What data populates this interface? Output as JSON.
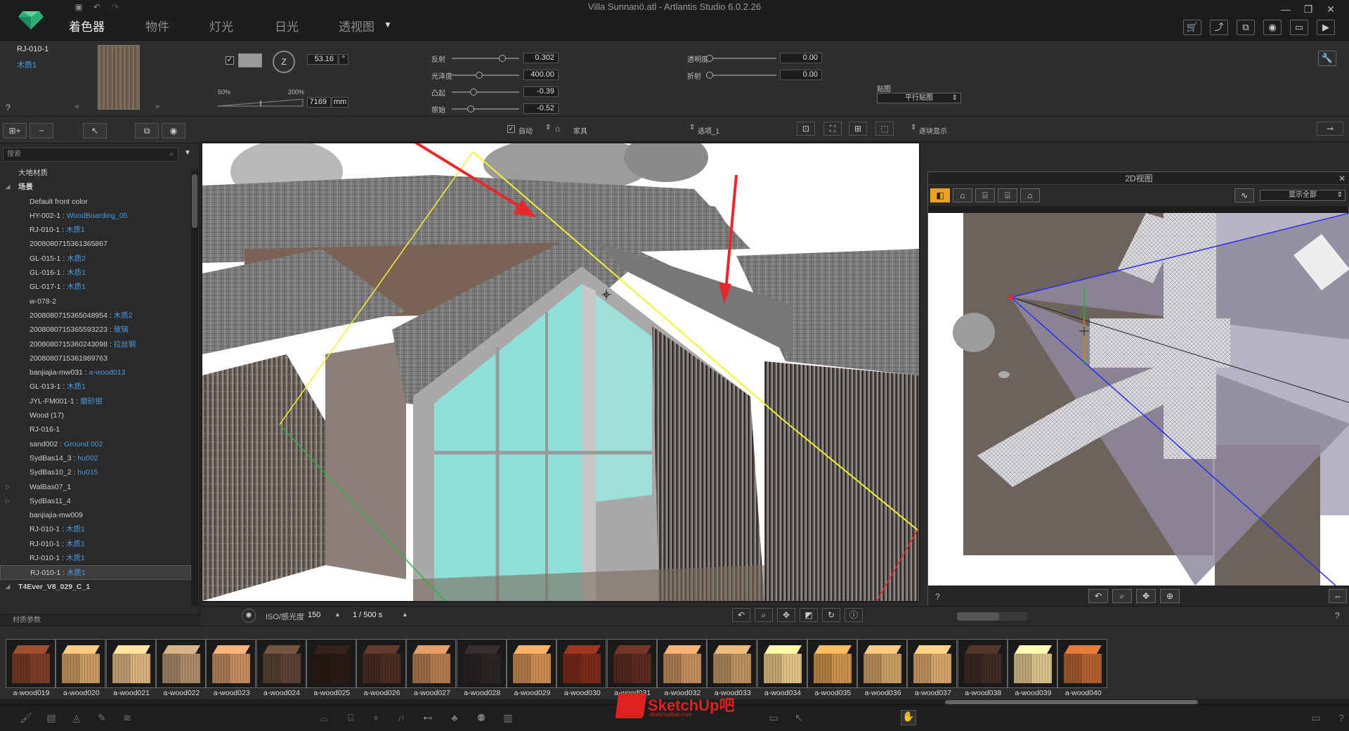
{
  "titlebar": {
    "window_title": "Villa Sunnanö.atl - Artlantis Studio 6.0.2.26",
    "tabs": [
      "着色器",
      "物件",
      "灯光",
      "日光",
      "透视图"
    ],
    "tab_dropdown": "▼",
    "window_controls": [
      "—",
      "❐",
      "✕"
    ],
    "toolbar_icons": [
      "cart-icon",
      "export-icon",
      "windows-icon",
      "camera-icon",
      "crop-icon",
      "render-icon"
    ]
  },
  "props": {
    "material_code": "RJ-010-1",
    "material_name": "木质1",
    "help": "?",
    "rotation_value": "53.16",
    "rotation_unit": "°",
    "rotation_axis": "Z",
    "scale_min": "50%",
    "scale_max": "200%",
    "size_value": "7169",
    "size_unit": "mm",
    "sliders_left": [
      {
        "label": "反射",
        "value": "0.302",
        "pos": 0.78
      },
      {
        "label": "光泽度",
        "value": "400.00",
        "pos": 0.4
      },
      {
        "label": "凸起",
        "value": "-0.39",
        "pos": 0.3
      },
      {
        "label": "原始",
        "value": "-0.52",
        "pos": 0.25
      }
    ],
    "sliders_right": [
      {
        "label": "透明度",
        "value": "0.00",
        "pos": 0.0
      },
      {
        "label": "折射",
        "value": "0.00",
        "pos": 0.0
      }
    ],
    "mapping_label": "贴图",
    "mapping_value": "平行贴图",
    "tool_icon": "wrench-icon"
  },
  "left": {
    "search_placeholder": "搜索",
    "tree": [
      {
        "text": "大地材质",
        "sub": "",
        "indent": 1,
        "bold": false
      },
      {
        "text": "场景",
        "sub": "",
        "indent": 1,
        "bold": true,
        "expand": "◢"
      },
      {
        "text": "Default front color",
        "sub": "",
        "indent": 2
      },
      {
        "text": "HY-002-1 : ",
        "sub": "WoodBoarding_05",
        "indent": 2
      },
      {
        "text": "RJ-010-1 : ",
        "sub": "木质1",
        "indent": 2
      },
      {
        "text": "20080807153613658​67",
        "sub": "",
        "indent": 2
      },
      {
        "text": "GL-015-1 : ",
        "sub": "木质2",
        "indent": 2
      },
      {
        "text": "GL-016-1 : ",
        "sub": "木质1",
        "indent": 2
      },
      {
        "text": "GL-017-1 : ",
        "sub": "木质1",
        "indent": 2
      },
      {
        "text": "w-078-2",
        "sub": "",
        "indent": 2
      },
      {
        "text": "2008080715365048954 : ",
        "sub": "木质2",
        "indent": 2
      },
      {
        "text": "2008080715365593223 : ",
        "sub": "玻璃",
        "indent": 2
      },
      {
        "text": "2008080715360243098 : ",
        "sub": "拉丝钢",
        "indent": 2
      },
      {
        "text": "2008080715361989763",
        "sub": "",
        "indent": 2
      },
      {
        "text": "banjiajia-mw031 : ",
        "sub": "a-wood013",
        "indent": 2
      },
      {
        "text": "GL-013-1 : ",
        "sub": "木质1",
        "indent": 2
      },
      {
        "text": "JYL-FM001-1 : ",
        "sub": "磨砂银",
        "indent": 2
      },
      {
        "text": "Wood (17)",
        "sub": "",
        "indent": 2
      },
      {
        "text": "RJ-016-1",
        "sub": "",
        "indent": 2
      },
      {
        "text": "sand002 : ",
        "sub": "Ground 002",
        "indent": 2
      },
      {
        "text": "SydBas14_3 : ",
        "sub": "hu002",
        "indent": 2
      },
      {
        "text": "SydBas10_2 : ",
        "sub": "hu015",
        "indent": 2
      },
      {
        "text": "WalBas07_1",
        "sub": "",
        "indent": 2,
        "expand": "▷"
      },
      {
        "text": "SydBas11_4",
        "sub": "",
        "indent": 2,
        "expand": "▷"
      },
      {
        "text": "banjiajia-mw009",
        "sub": "",
        "indent": 2
      },
      {
        "text": "RJ-010-1 : ",
        "sub": "木质1",
        "indent": 2
      },
      {
        "text": "RJ-010-1 : ",
        "sub": "木质1",
        "indent": 2
      },
      {
        "text": "RJ-010-1 : ",
        "sub": "木质1",
        "indent": 2
      },
      {
        "text": "RJ-010-1 : ",
        "sub": "木质1",
        "indent": 2,
        "selected": true
      },
      {
        "text": "T4Ever_V8_029_C_1",
        "sub": "",
        "indent": 1,
        "bold": true,
        "expand": "◢"
      }
    ],
    "footer": "材质参数"
  },
  "viewtool": {
    "auto_label": "自动",
    "furniture_label": "家具",
    "layer_value": "选项_1",
    "display_label": "逐块显示"
  },
  "view2d": {
    "title": "2D视图",
    "display_all": "显示全部",
    "help": "?"
  },
  "status": {
    "iso_label": "ISO/感光度",
    "iso_value": "150",
    "shutter_value": "1 / 500 s",
    "help": "?"
  },
  "materials": [
    "a-wood019",
    "a-wood020",
    "a-wood021",
    "a-wood022",
    "a-wood023",
    "a-wood024",
    "a-wood025",
    "a-wood026",
    "a-wood027",
    "a-wood028",
    "a-wood029",
    "a-wood030",
    "a-wood031",
    "a-wood032",
    "a-wood033",
    "a-wood034",
    "a-wood035",
    "a-wood036",
    "a-wood037",
    "a-wood038",
    "a-wood039",
    "a-wood040"
  ],
  "watermark": {
    "brand": "SketchUp吧",
    "url": "sketchupbar.com"
  },
  "colors": {
    "accent_blue": "#4a9be0",
    "arrow_red": "#e8282a",
    "camera_yellow": "#f2f230",
    "glass_cyan": "#8fe0d8"
  }
}
